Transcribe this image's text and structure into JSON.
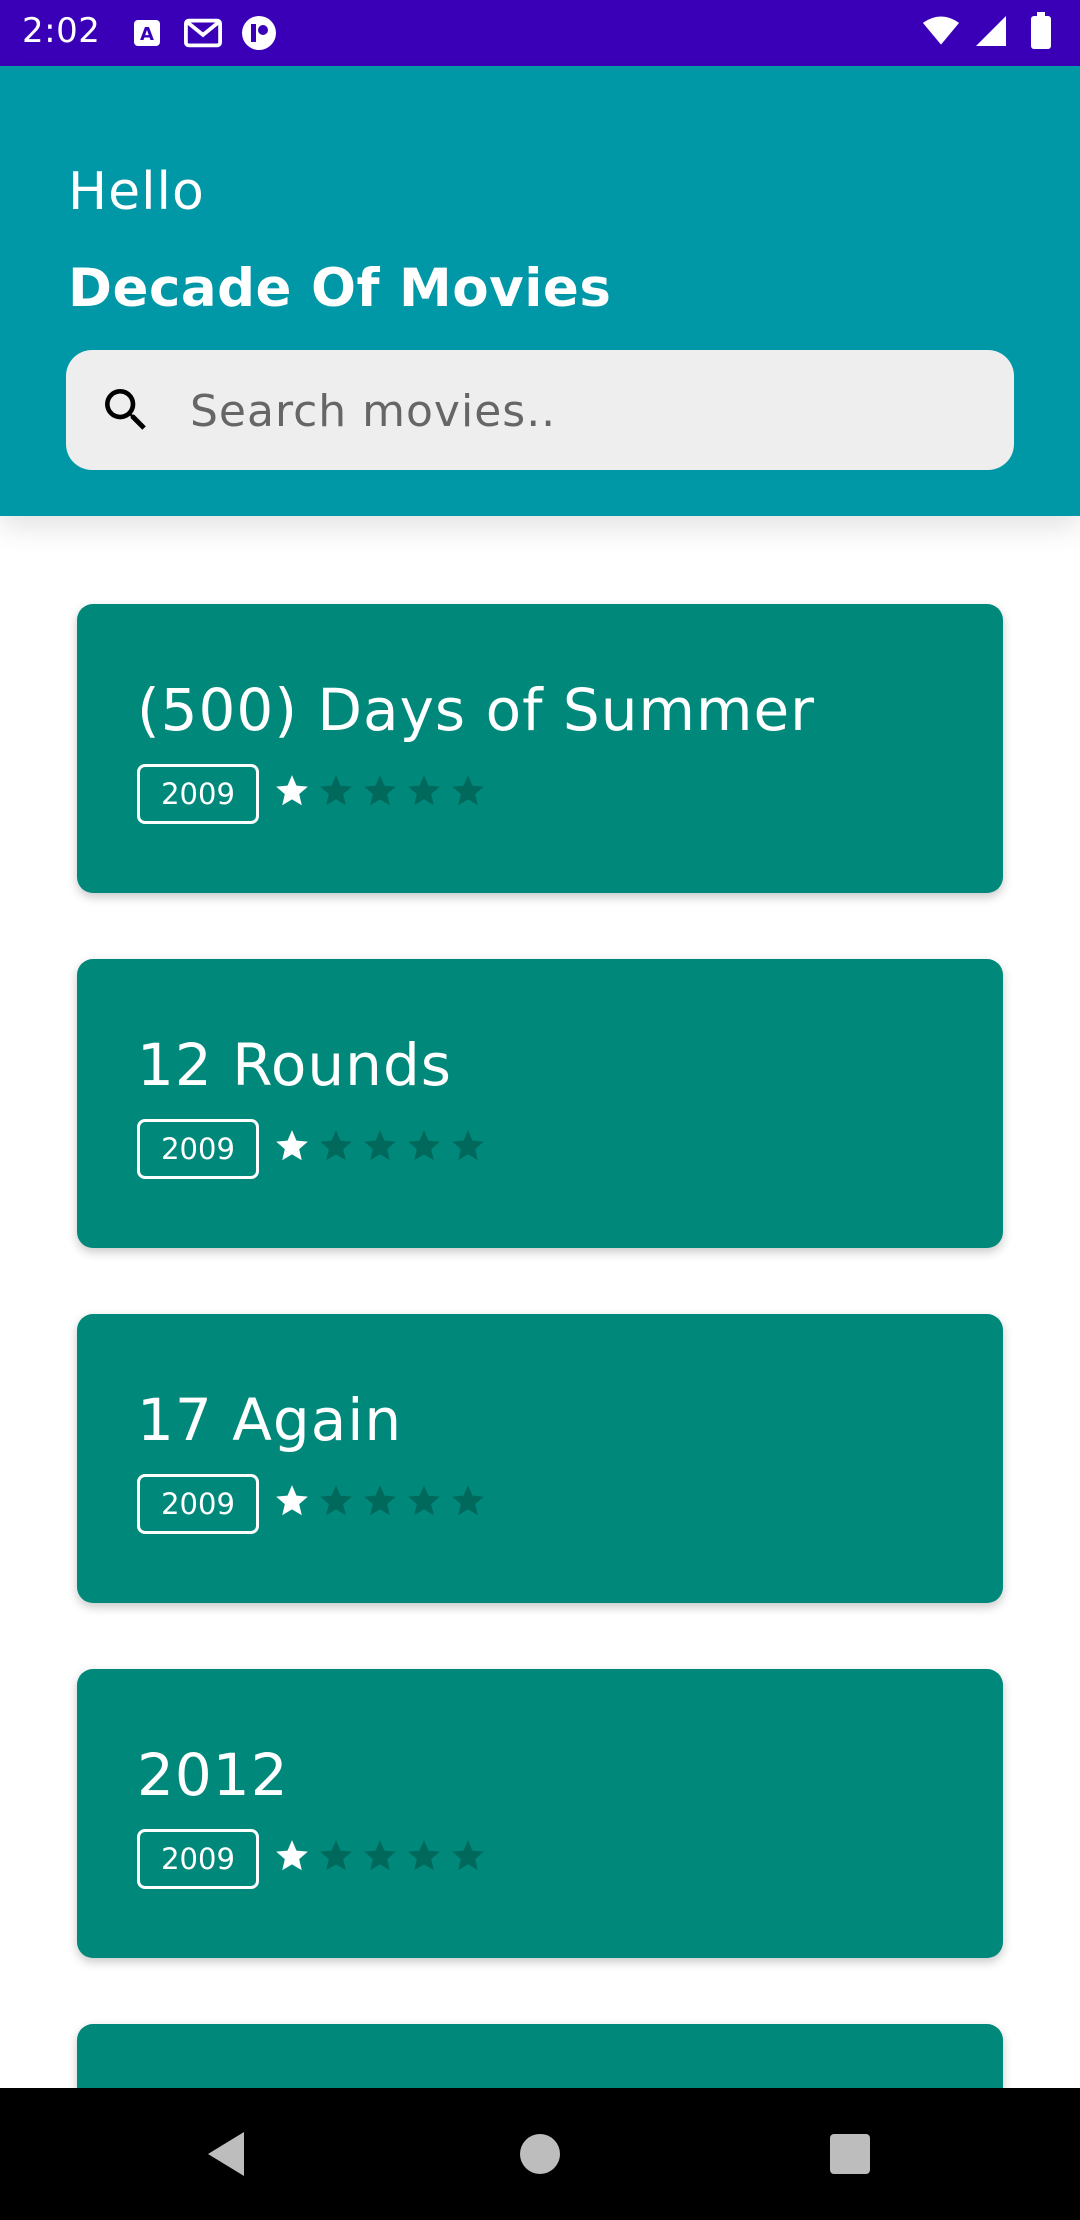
{
  "status_bar": {
    "time": "2:02",
    "left_icons": [
      "accessibility-icon",
      "gmail-icon",
      "app-icon"
    ],
    "right_icons": [
      "wifi-icon",
      "signal-icon",
      "battery-icon"
    ]
  },
  "header": {
    "greeting": "Hello",
    "title": "Decade Of Movies",
    "search_placeholder": "Search movies.."
  },
  "movies": [
    {
      "title": "(500) Days of Summer",
      "year": "2009",
      "rating": 1,
      "rating_max": 5
    },
    {
      "title": "12 Rounds",
      "year": "2009",
      "rating": 1,
      "rating_max": 5
    },
    {
      "title": "17 Again",
      "year": "2009",
      "rating": 1,
      "rating_max": 5
    },
    {
      "title": "2012",
      "year": "2009",
      "rating": 1,
      "rating_max": 5
    }
  ],
  "nav_bar": {
    "buttons": [
      "back-icon",
      "home-icon",
      "recents-icon"
    ]
  },
  "colors": {
    "status_bar": "#3a00b8",
    "header": "#0097a7",
    "card": "#00897b",
    "star_empty": "#00695c",
    "star_filled": "#ffffff"
  }
}
